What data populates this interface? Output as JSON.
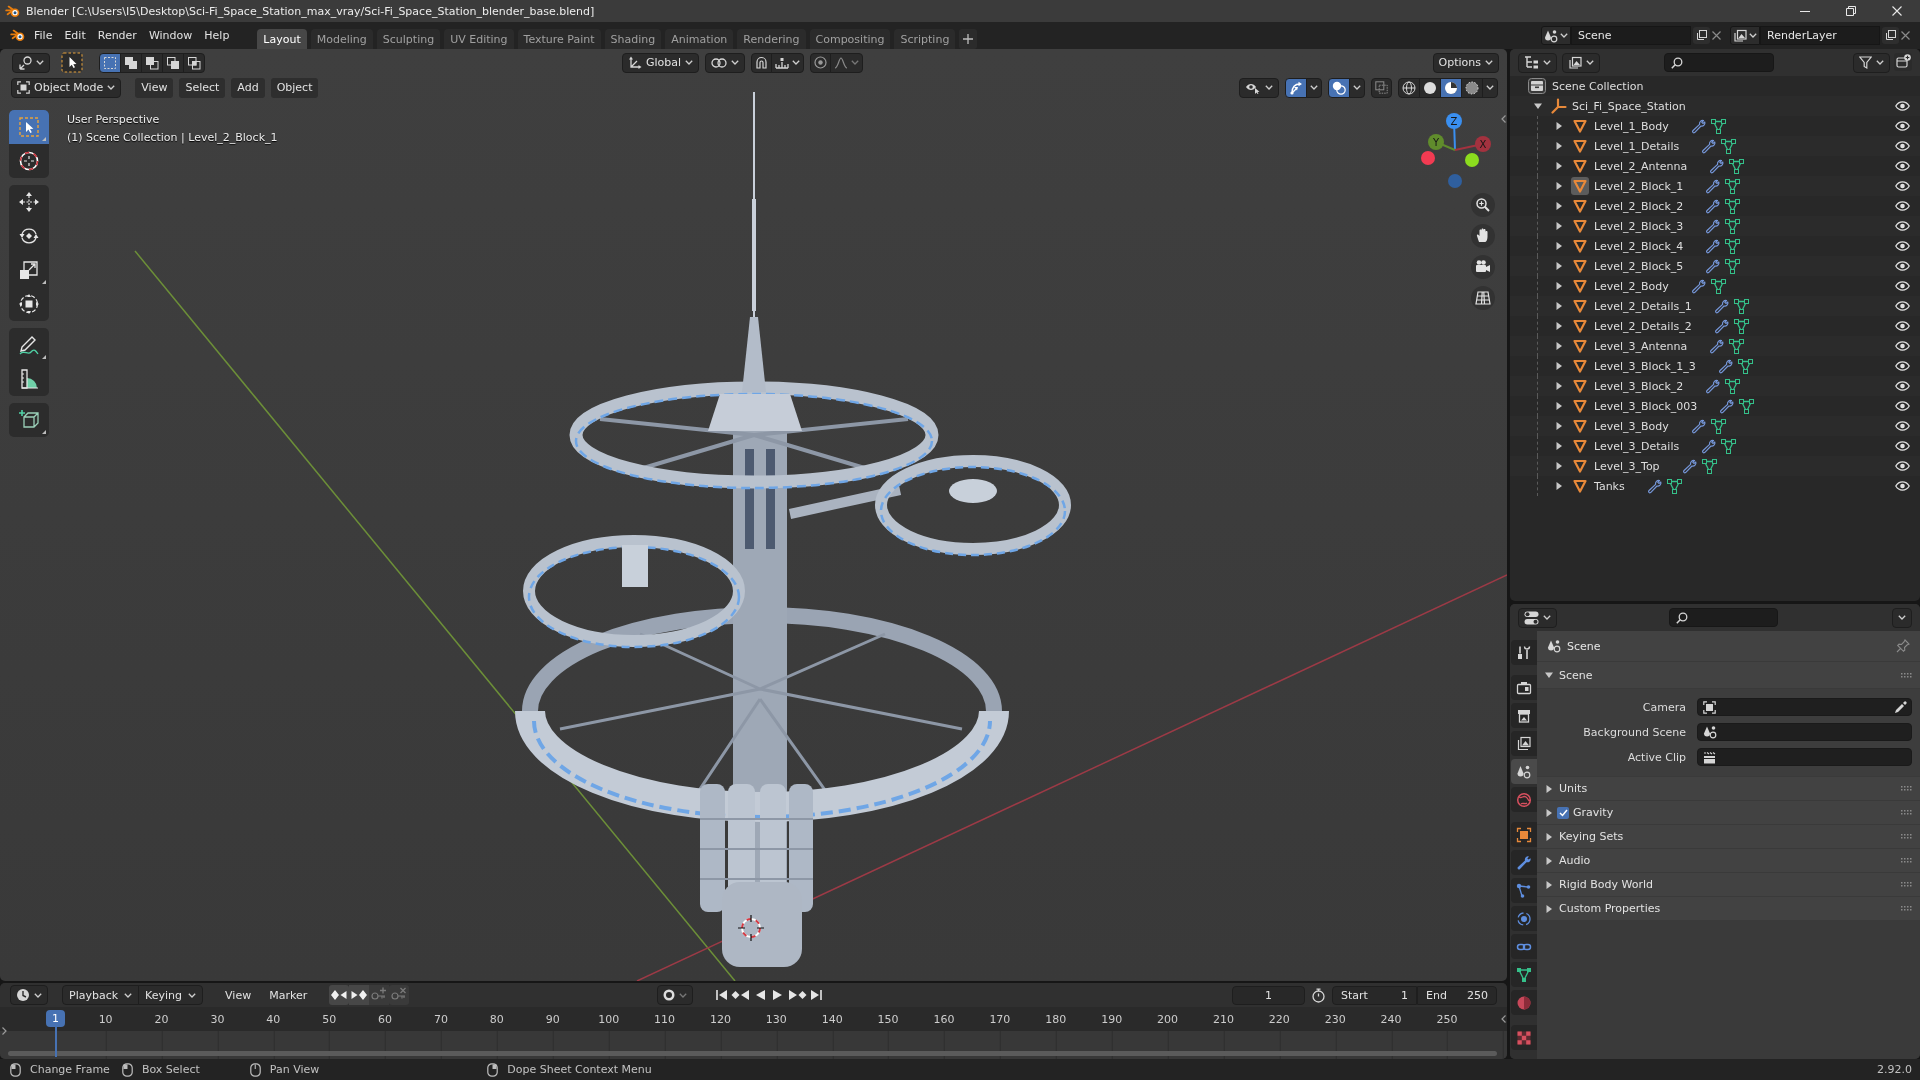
{
  "window": {
    "title": "Blender [C:\\Users\\I5\\Desktop\\Sci-Fi_Space_Station_max_vray/Sci-Fi_Space_Station_blender_base.blend]"
  },
  "menu_bar": [
    "File",
    "Edit",
    "Render",
    "Window",
    "Help"
  ],
  "workspace_tabs": [
    {
      "label": "Layout",
      "selected": true
    },
    {
      "label": "Modeling",
      "selected": false
    },
    {
      "label": "Sculpting",
      "selected": false
    },
    {
      "label": "UV Editing",
      "selected": false
    },
    {
      "label": "Texture Paint",
      "selected": false
    },
    {
      "label": "Shading",
      "selected": false
    },
    {
      "label": "Animation",
      "selected": false
    },
    {
      "label": "Rendering",
      "selected": false
    },
    {
      "label": "Compositing",
      "selected": false
    },
    {
      "label": "Scripting",
      "selected": false
    }
  ],
  "scene_selector": {
    "value": "Scene"
  },
  "view_layer_selector": {
    "value": "RenderLayer"
  },
  "viewport": {
    "select_modes": [
      {
        "selected": true
      },
      {
        "selected": false
      },
      {
        "selected": false
      },
      {
        "selected": false
      },
      {
        "selected": false
      }
    ],
    "orientation": "Global",
    "options": "Options",
    "mode": "Object Mode",
    "menus": [
      "View",
      "Select",
      "Add",
      "Object"
    ],
    "show_gizmos": true,
    "show_overlays": true,
    "xray": false,
    "shading_modes": [
      {
        "selected": false
      },
      {
        "selected": false
      },
      {
        "selected": true
      },
      {
        "selected": false
      }
    ],
    "overlay_text": [
      "User Perspective",
      "(1) Scene Collection | Level_2_Block_1"
    ],
    "tools": [
      {
        "selected": true
      },
      {
        "selected": false
      },
      {
        "selected": false
      },
      {
        "selected": false
      },
      {
        "selected": false
      },
      {
        "selected": false
      },
      {
        "selected": false
      },
      {
        "selected": false
      },
      {
        "selected": false
      }
    ],
    "gizmo_axes": [
      {
        "label": "Z",
        "color": "#3a8ff0"
      },
      {
        "label": "Y",
        "color": "#608c2c"
      },
      {
        "label": "X",
        "color": "#a3323f"
      },
      {
        "color": "#f23b52"
      },
      {
        "color": "#8cdc1e"
      },
      {
        "color": "#2f5f9e"
      }
    ]
  },
  "outliner": {
    "tree": [
      {
        "label": "Scene Collection",
        "children": [
          {
            "label": "Sci_Fi_Space_Station",
            "expanded": true,
            "visible": true,
            "children": [
              {
                "label": "Level_1_Body",
                "expanded": false,
                "active": false,
                "visible": true
              },
              {
                "label": "Level_1_Details",
                "expanded": false,
                "active": false,
                "visible": true
              },
              {
                "label": "Level_2_Antenna",
                "expanded": false,
                "active": false,
                "visible": true
              },
              {
                "label": "Level_2_Block_1",
                "expanded": false,
                "active": true,
                "visible": true
              },
              {
                "label": "Level_2_Block_2",
                "expanded": false,
                "active": false,
                "visible": true
              },
              {
                "label": "Level_2_Block_3",
                "expanded": false,
                "active": false,
                "visible": true
              },
              {
                "label": "Level_2_Block_4",
                "expanded": false,
                "active": false,
                "visible": true
              },
              {
                "label": "Level_2_Block_5",
                "expanded": false,
                "active": false,
                "visible": true
              },
              {
                "label": "Level_2_Body",
                "expanded": false,
                "active": false,
                "visible": true
              },
              {
                "label": "Level_2_Details_1",
                "expanded": false,
                "active": false,
                "visible": true
              },
              {
                "label": "Level_2_Details_2",
                "expanded": false,
                "active": false,
                "visible": true
              },
              {
                "label": "Level_3_Antenna",
                "expanded": false,
                "active": false,
                "visible": true
              },
              {
                "label": "Level_3_Block_1_3",
                "expanded": false,
                "active": false,
                "visible": true
              },
              {
                "label": "Level_3_Block_2",
                "expanded": false,
                "active": false,
                "visible": true
              },
              {
                "label": "Level_3_Block_003",
                "expanded": false,
                "active": false,
                "visible": true
              },
              {
                "label": "Level_3_Body",
                "expanded": false,
                "active": false,
                "visible": true
              },
              {
                "label": "Level_3_Details",
                "expanded": false,
                "active": false,
                "visible": true
              },
              {
                "label": "Level_3_Top",
                "expanded": false,
                "active": false,
                "visible": true
              },
              {
                "label": "Tanks",
                "expanded": false,
                "active": false,
                "visible": true
              }
            ]
          }
        ]
      }
    ]
  },
  "properties": {
    "tabs": [
      {
        "selected": false
      },
      {
        "selected": false
      },
      {
        "selected": false
      },
      {
        "selected": false
      },
      {
        "selected": true
      },
      {
        "selected": false
      },
      {
        "selected": false
      },
      {
        "selected": false
      },
      {
        "selected": false
      },
      {
        "selected": false
      },
      {
        "selected": false
      },
      {
        "selected": false
      },
      {
        "selected": false
      },
      {
        "selected": false
      }
    ],
    "context": "Scene",
    "panels": [
      {
        "label": "Scene",
        "expanded": true,
        "fields": [
          {
            "label": "Camera"
          },
          {
            "label": "Background Scene"
          },
          {
            "label": "Active Clip"
          }
        ]
      },
      {
        "label": "Units",
        "expanded": false
      },
      {
        "label": "Gravity",
        "expanded": false,
        "checked": true
      },
      {
        "label": "Keying Sets",
        "expanded": false
      },
      {
        "label": "Audio",
        "expanded": false
      },
      {
        "label": "Rigid Body World",
        "expanded": false
      },
      {
        "label": "Custom Properties",
        "expanded": false
      }
    ]
  },
  "timeline": {
    "dropdowns": [
      "Playback",
      "Keying"
    ],
    "menus": [
      "View",
      "Marker"
    ],
    "current_frame": "1",
    "start": {
      "label": "Start",
      "value": "1"
    },
    "end": {
      "label": "End",
      "value": "250"
    },
    "playhead": "1",
    "ruler": [
      "10",
      "20",
      "30",
      "40",
      "50",
      "60",
      "70",
      "80",
      "90",
      "100",
      "110",
      "120",
      "130",
      "140",
      "150",
      "160",
      "170",
      "180",
      "190",
      "200",
      "210",
      "220",
      "230",
      "240",
      "250"
    ]
  },
  "status_bar": {
    "hints": [
      "Change Frame",
      "Box Select",
      "Pan View",
      "Dope Sheet Context Menu"
    ],
    "version": "2.92.0"
  }
}
